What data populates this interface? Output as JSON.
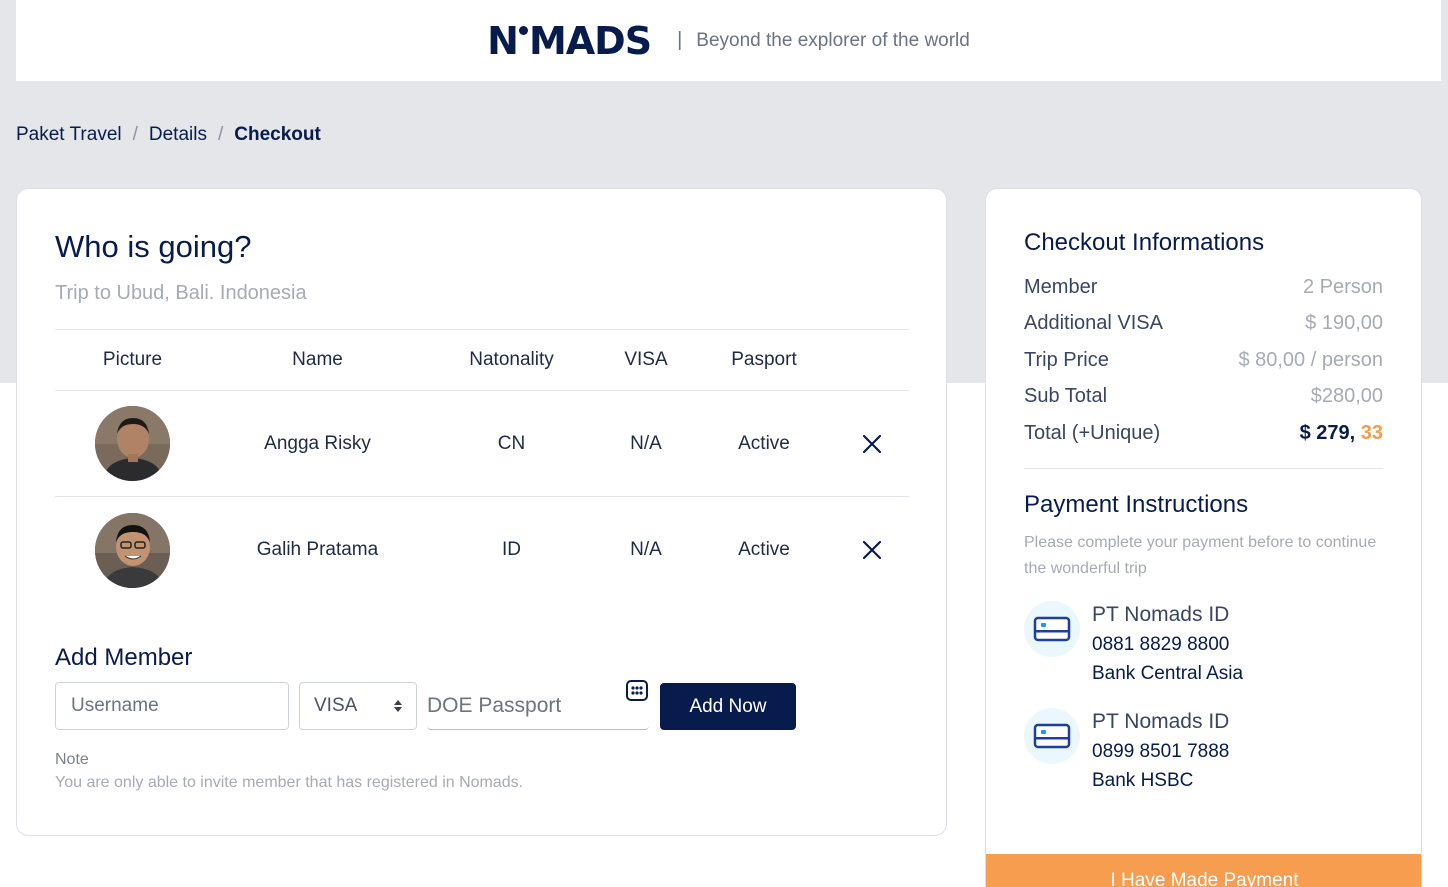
{
  "header": {
    "logo_text_left": "N",
    "logo_text_right": "MADS",
    "tagline_separator": "|",
    "tagline": "Beyond the explorer of the world"
  },
  "breadcrumb": {
    "items": [
      "Paket Travel",
      "Details",
      "Checkout"
    ],
    "separator": "/"
  },
  "who": {
    "title": "Who is going?",
    "subtitle": "Trip to Ubud, Bali. Indonesia",
    "columns": [
      "Picture",
      "Name",
      "Natonality",
      "VISA",
      "Pasport"
    ],
    "members": [
      {
        "name": "Angga Risky",
        "nationality": "CN",
        "visa": "N/A",
        "passport": "Active",
        "remove_icon": "close-icon"
      },
      {
        "name": "Galih Pratama",
        "nationality": "ID",
        "visa": "N/A",
        "passport": "Active",
        "remove_icon": "close-icon"
      }
    ]
  },
  "add_member": {
    "title": "Add Member",
    "username_placeholder": "Username",
    "visa_selected": "VISA",
    "doe_placeholder": "DOE Passport",
    "button": "Add Now",
    "note_label": "Note",
    "note_text": "You are only able to invite member that has registered in Nomads."
  },
  "checkout": {
    "title": "Checkout Informations",
    "rows": [
      {
        "label": "Member",
        "value": "2 Person"
      },
      {
        "label": "Additional VISA",
        "value": "$ 190,00"
      },
      {
        "label": "Trip Price",
        "value": "$ 80,00 / person"
      },
      {
        "label": "Sub Total",
        "value": "$280,00"
      }
    ],
    "total_label": "Total (+Unique)",
    "total_main": "$ 279,",
    "total_cents": " 33"
  },
  "payment": {
    "title": "Payment Instructions",
    "description": "Please complete your payment before to continue the wonderful trip",
    "banks": [
      {
        "name": "PT Nomads ID",
        "number": "0881 8829 8800",
        "bank": "Bank Central Asia"
      },
      {
        "name": "PT Nomads ID",
        "number": "0899 8501 7888",
        "bank": "Bank HSBC"
      }
    ],
    "button": "I Have Made Payment"
  },
  "colors": {
    "navy": "#071c4d",
    "accent_orange": "#f79d4f",
    "background_band": "#e5e6ea"
  }
}
